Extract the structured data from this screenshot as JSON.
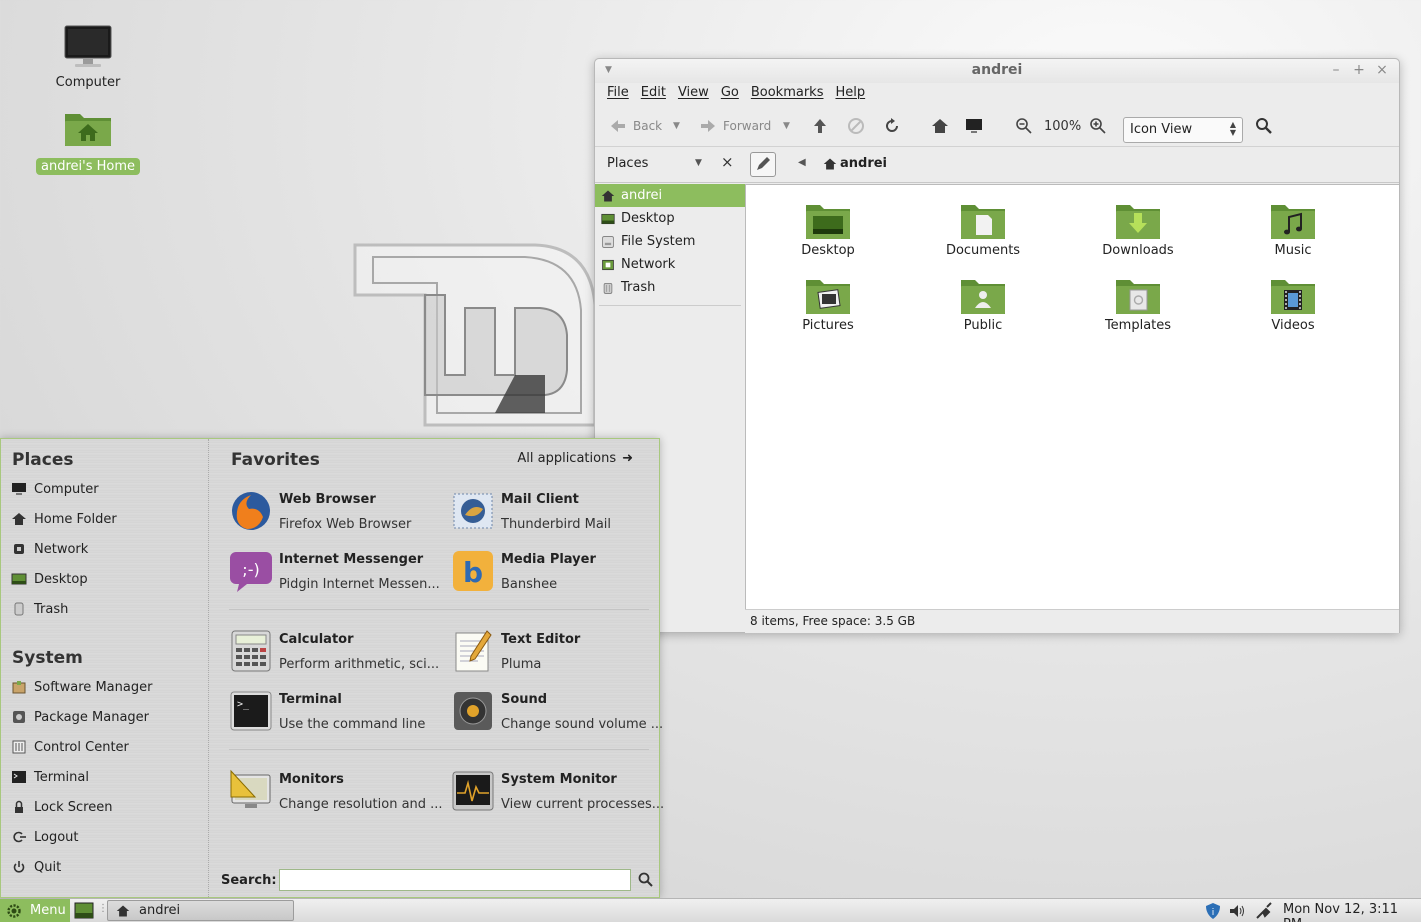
{
  "desktop": {
    "icons": [
      {
        "label": "Computer",
        "icon": "computer-icon"
      },
      {
        "label": "andrei's Home",
        "icon": "home-folder-icon"
      }
    ]
  },
  "file_manager": {
    "title": "andrei",
    "menus": [
      "File",
      "Edit",
      "View",
      "Go",
      "Bookmarks",
      "Help"
    ],
    "toolbar": {
      "back": "Back",
      "forward": "Forward",
      "zoom": "100%",
      "view_mode": "Icon View"
    },
    "places_header": "Places",
    "path": "andrei",
    "sidebar": [
      {
        "label": "andrei",
        "icon": "home-icon",
        "selected": true
      },
      {
        "label": "Desktop",
        "icon": "desktop-icon"
      },
      {
        "label": "File System",
        "icon": "drive-icon"
      },
      {
        "label": "Network",
        "icon": "network-icon"
      },
      {
        "label": "Trash",
        "icon": "trash-icon"
      }
    ],
    "folders": [
      {
        "label": "Desktop",
        "icon": "desktop-folder-icon"
      },
      {
        "label": "Documents",
        "icon": "documents-folder-icon"
      },
      {
        "label": "Downloads",
        "icon": "downloads-folder-icon"
      },
      {
        "label": "Music",
        "icon": "music-folder-icon"
      },
      {
        "label": "Pictures",
        "icon": "pictures-folder-icon"
      },
      {
        "label": "Public",
        "icon": "public-folder-icon"
      },
      {
        "label": "Templates",
        "icon": "templates-folder-icon"
      },
      {
        "label": "Videos",
        "icon": "videos-folder-icon"
      }
    ],
    "status": "8 items, Free space: 3.5 GB"
  },
  "menu": {
    "places_heading": "Places",
    "places": [
      "Computer",
      "Home Folder",
      "Network",
      "Desktop",
      "Trash"
    ],
    "system_heading": "System",
    "system": [
      "Software Manager",
      "Package Manager",
      "Control Center",
      "Terminal",
      "Lock Screen",
      "Logout",
      "Quit"
    ],
    "favorites_heading": "Favorites",
    "all_apps": "All applications",
    "favorites": [
      {
        "name": "Web Browser",
        "desc": "Firefox Web Browser",
        "icon": "firefox-icon"
      },
      {
        "name": "Mail Client",
        "desc": "Thunderbird Mail",
        "icon": "thunderbird-icon"
      },
      {
        "name": "Internet Messenger",
        "desc": "Pidgin Internet Messen...",
        "icon": "pidgin-icon"
      },
      {
        "name": "Media Player",
        "desc": "Banshee",
        "icon": "banshee-icon"
      },
      {
        "name": "Calculator",
        "desc": "Perform arithmetic, sci...",
        "icon": "calculator-icon"
      },
      {
        "name": "Text Editor",
        "desc": "Pluma",
        "icon": "text-editor-icon"
      },
      {
        "name": "Terminal",
        "desc": "Use the command line",
        "icon": "terminal-icon"
      },
      {
        "name": "Sound",
        "desc": "Change sound volume ...",
        "icon": "sound-icon"
      },
      {
        "name": "Monitors",
        "desc": "Change resolution and ...",
        "icon": "monitors-icon"
      },
      {
        "name": "System Monitor",
        "desc": "View current processes...",
        "icon": "system-monitor-icon"
      }
    ],
    "search_label": "Search:",
    "search_value": ""
  },
  "panel": {
    "menu_label": "Menu",
    "task_label": "andrei",
    "clock": "Mon Nov 12,  3:11 PM"
  },
  "colors": {
    "accent": "#8dbd5e",
    "folder_green": "#7aa84a"
  }
}
